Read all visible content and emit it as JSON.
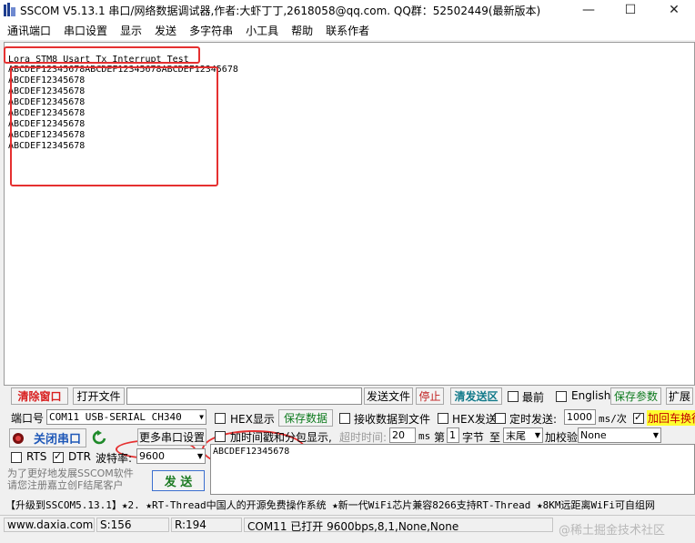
{
  "window": {
    "title": "SSCOM V5.13.1 串口/网络数据调试器,作者:大虾丁丁,2618058@qq.com. QQ群：52502449(最新版本)",
    "minimize": "—",
    "maximize": "☐",
    "close": "✕"
  },
  "menu": [
    "通讯端口",
    "串口设置",
    "显示",
    "发送",
    "多字符串",
    "小工具",
    "帮助",
    "联系作者"
  ],
  "receive": {
    "lines": [
      "Lora STM8 Usart Tx Interrupt Test",
      "ABCDEF12345678ABCDEF12345678ABCDEF12345678",
      "ABCDEF12345678",
      "ABCDEF12345678",
      "ABCDEF12345678",
      "ABCDEF12345678",
      "ABCDEF12345678",
      "ABCDEF12345678",
      "ABCDEF12345678",
      "ABCDEF12345678"
    ]
  },
  "toolbar1": {
    "clear_window": "清除窗口",
    "open_file": "打开文件",
    "send_file": "发送文件",
    "stop": "停止",
    "clear_send": "清发送区",
    "topmost": "最前",
    "english": "English",
    "save_params": "保存参数",
    "expand": "扩展"
  },
  "serial": {
    "port_label": "端口号",
    "port_value": "COM11 USB-SERIAL CH340",
    "close_port": "关闭串口",
    "more_settings": "更多串口设置",
    "rts": "RTS",
    "dtr": "DTR",
    "baud_label": "波特率:",
    "baud_value": "9600"
  },
  "display_opts": {
    "hex_display": "HEX显示",
    "save_data": "保存数据",
    "recv_to_file": "接收数据到文件",
    "hex_send": "HEX发送",
    "timed_send": "定时发送:",
    "interval": "1000",
    "interval_unit": "ms/次",
    "add_crlf": "加回车换行",
    "timestamp": "加时间戳和分包显示,",
    "timeout_label": "超时时间:",
    "timeout_value": "20",
    "ms": "ms",
    "nth": "第",
    "byte_index": "1",
    "byte_label": "字节",
    "to": "至",
    "end_value": "末尾",
    "checksum_label": "加校验",
    "checksum_value": "None"
  },
  "send": {
    "text": "ABCDEF12345678",
    "send_button": "发 送",
    "promo": "为了更好地发展SSCOM软件\n请您注册嘉立创F结尾客户"
  },
  "ticker": "【升级到SSCOM5.13.1】★2. ★RT-Thread中国人的开源免费操作系统 ★新一代WiFi芯片兼容8266支持RT-Thread ★8KM远距离WiFi可自组网",
  "status": {
    "website": "www.daxia.com",
    "sent": "S:156",
    "received": "R:194",
    "port_state": "COM11 已打开  9600bps,8,1,None,None"
  },
  "watermark": "@稀土掘金技术社区"
}
